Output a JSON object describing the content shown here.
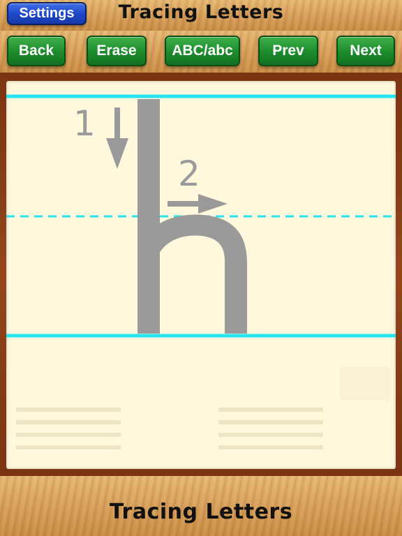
{
  "header": {
    "settings_label": "Settings",
    "title": "Tracing Letters"
  },
  "toolbar": {
    "back_label": "Back",
    "erase_label": "Erase",
    "case_label": "ABC/abc",
    "prev_label": "Prev",
    "next_label": "Next"
  },
  "tracing": {
    "letter": "h",
    "stroke_1_number": "1",
    "stroke_2_number": "2",
    "guide_color": "#27e3ef",
    "letter_color": "#9a9a9a"
  },
  "footer": {
    "title": "Tracing Letters"
  }
}
